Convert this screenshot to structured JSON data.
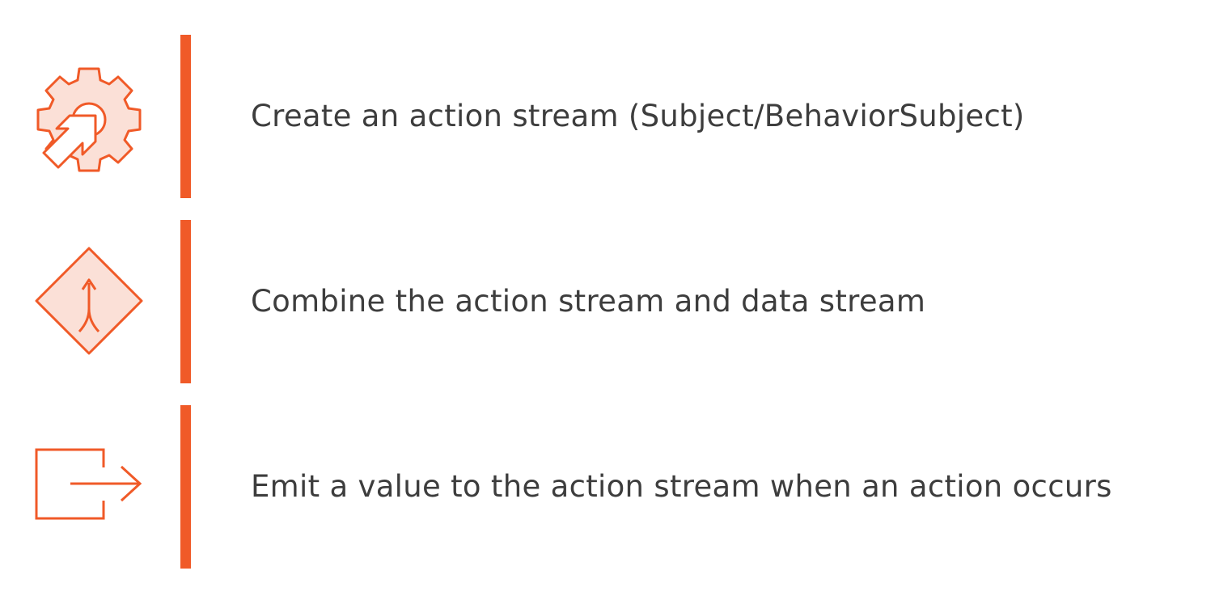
{
  "accent_color": "#f05a28",
  "icon_fill_color": "#fbe0d7",
  "text_color": "#3d3d3d",
  "steps": [
    {
      "icon": "gear-arrow-icon",
      "label": "Create an action stream (Subject/BehaviorSubject)"
    },
    {
      "icon": "merge-diamond-icon",
      "label": "Combine the action stream and data stream"
    },
    {
      "icon": "exit-arrow-icon",
      "label": "Emit a value to the action stream when an action occurs"
    }
  ]
}
